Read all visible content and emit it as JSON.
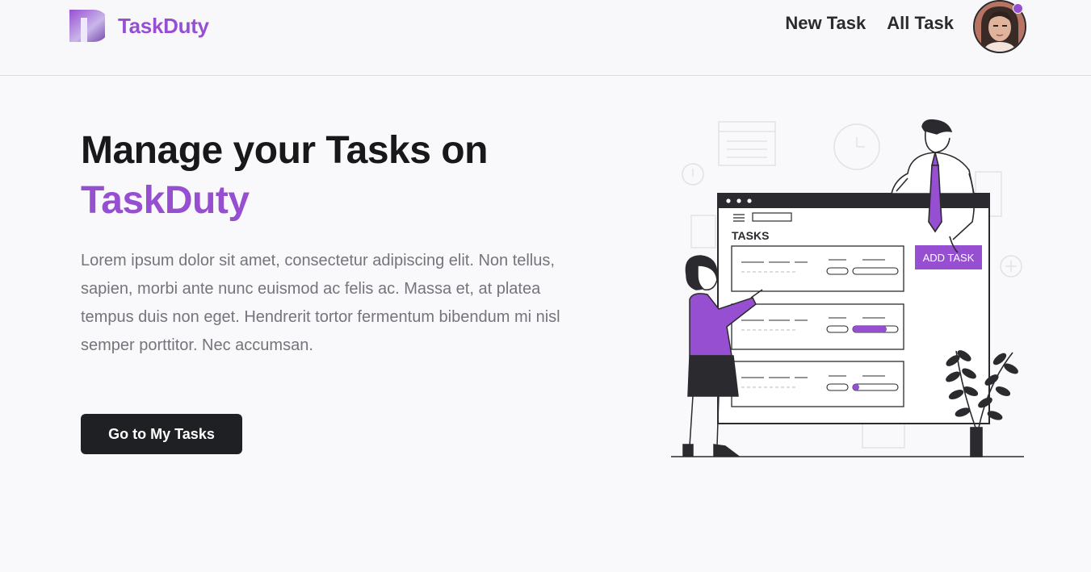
{
  "brand": {
    "name": "TaskDuty",
    "logo_icon": "letter-t-logo-icon"
  },
  "nav": {
    "new_task": "New Task",
    "all_task": "All Task",
    "avatar_icon": "user-avatar-icon"
  },
  "hero": {
    "title_line1": "Manage your Tasks on",
    "title_line2": "TaskDuty",
    "body": "Lorem ipsum dolor sit amet, consectetur adipiscing elit. Non tellus, sapien, morbi ante nunc euismod ac felis ac. Massa et, at platea tempus duis non eget. Hendrerit tortor fermentum bibendum mi nisl semper porttitor. Nec accumsan.",
    "cta_label": "Go to My Tasks"
  },
  "illustration": {
    "board_title": "TASKS",
    "add_task_label": "ADD TASK",
    "icon": "task-board-illustration"
  },
  "colors": {
    "accent": "#974fd2",
    "dark": "#1f2023",
    "muted_text": "#74747c",
    "background": "#f9f9fb"
  }
}
